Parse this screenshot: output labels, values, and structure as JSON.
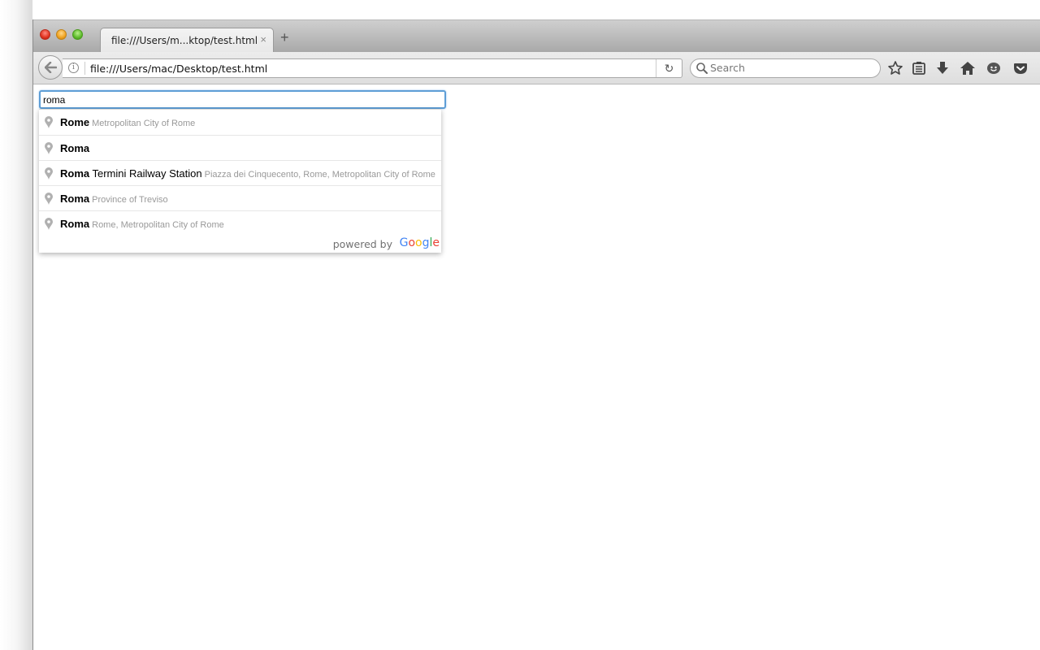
{
  "browser": {
    "tab_title": "file:///Users/m...ktop/test.html",
    "tab_close_glyph": "×",
    "new_tab_glyph": "+",
    "url": "file:///Users/mac/Desktop/test.html",
    "info_glyph": "i",
    "reload_glyph": "↻",
    "search_placeholder": "Search",
    "toolbar_icons": [
      "bookmark-star-icon",
      "reading-list-icon",
      "download-icon",
      "home-icon",
      "hello-chat-icon",
      "pocket-icon"
    ]
  },
  "page": {
    "place_input_value": "roma",
    "suggestions": [
      {
        "main": "Rome",
        "main_rest": "",
        "secondary": "Metropolitan City of Rome"
      },
      {
        "main": "Roma",
        "main_rest": "",
        "secondary": ""
      },
      {
        "main": "Roma",
        "main_rest": " Termini Railway Station",
        "secondary": "Piazza dei Cinquecento, Rome, Metropolitan City of Rome"
      },
      {
        "main": "Roma",
        "main_rest": "",
        "secondary": "Province of Treviso"
      },
      {
        "main": "Roma",
        "main_rest": "",
        "secondary": "Rome, Metropolitan City of Rome"
      }
    ],
    "powered_by": "powered by",
    "google_letters": [
      {
        "ch": "G",
        "color": "#4285f4"
      },
      {
        "ch": "o",
        "color": "#ea4335"
      },
      {
        "ch": "o",
        "color": "#fbbc05"
      },
      {
        "ch": "g",
        "color": "#4285f4"
      },
      {
        "ch": "l",
        "color": "#34a853"
      },
      {
        "ch": "e",
        "color": "#ea4335"
      }
    ]
  },
  "colors": {
    "focus_border": "#5e9ed6",
    "secondary_text": "#999999"
  }
}
